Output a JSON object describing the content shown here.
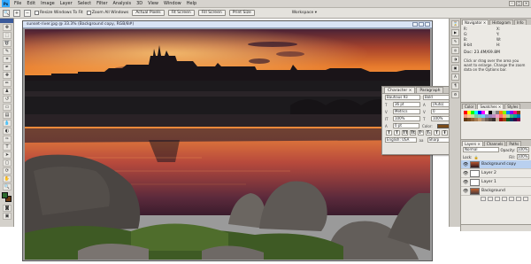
{
  "menubar": {
    "app_badge": "Ps",
    "items": [
      "File",
      "Edit",
      "Image",
      "Layer",
      "Select",
      "Filter",
      "Analysis",
      "3D",
      "View",
      "Window",
      "Help"
    ]
  },
  "options": {
    "tool_glyph": "🔍",
    "resize_windows_label": "Resize Windows To Fit",
    "zoom_all_label": "Zoom All Windows",
    "actual_pixels_label": "Actual Pixels",
    "fit_screen_label": "Fit Screen",
    "fill_screen_label": "Fill Screen",
    "print_size_label": "Print Size",
    "workspace_label": "Workspace ▾"
  },
  "document": {
    "title": "sunset-river.jpg @ 33.3% (Background copy, RGB/8#)"
  },
  "character_panel": {
    "tabs": [
      "Character ×",
      "Paragraph"
    ],
    "font_family": "Bauhaus 93",
    "font_style": "Bold",
    "font_size": "36 pt",
    "leading": "(Auto)",
    "tracking": "0",
    "kerning": "Metrics",
    "vscale": "100%",
    "hscale": "100%",
    "baseline": "0 pt",
    "color_label": "Color:",
    "style_buttons": [
      "T",
      "T",
      "TT",
      "Tt",
      "T¹",
      "T₁",
      "T",
      "Ŧ"
    ],
    "language": "English: USA",
    "antialias": "Sharp"
  },
  "navigator": {
    "tabs": [
      "Navigator ×",
      "Histogram",
      "Info"
    ],
    "doc_size": "Doc: 23.4M/69.8M",
    "info_values": [
      "R:",
      "G:",
      "B:",
      "8-bit",
      "X:",
      "Y:",
      "W:",
      "H:"
    ],
    "help_text": "Click or drag over the area you want to enlarge. Change the zoom data on the Options bar."
  },
  "swatches": {
    "tabs": [
      "Color",
      "Swatches ×",
      "Styles"
    ],
    "colors": [
      "#ff0000",
      "#ffff00",
      "#00ff00",
      "#00ffff",
      "#0000ff",
      "#ff00ff",
      "#ffffff",
      "#000000",
      "#c0c0c0",
      "#808080",
      "#ff8000",
      "#80ff00",
      "#0080ff",
      "#8000ff",
      "#ff0080",
      "#804000",
      "#f7977a",
      "#fdc68a",
      "#c4df9b",
      "#82ca9d",
      "#7bcdc8",
      "#6ecff6",
      "#8493ca",
      "#a187be",
      "#bc8dbf",
      "#f49ac2",
      "#f26d7d",
      "#fbaf5d",
      "#a3d39c",
      "#3cb878",
      "#00a99d",
      "#0072bc",
      "#603913",
      "#754c24",
      "#8c6239",
      "#a67c52",
      "#c69c6d",
      "#998675",
      "#736357",
      "#534741",
      "#362f2d",
      "#c7b299",
      "#9e0b0f",
      "#a0410d",
      "#005e20",
      "#003663",
      "#32004b",
      "#7b0046"
    ]
  },
  "layers": {
    "tabs": [
      "Layers ×",
      "Channels",
      "Paths"
    ],
    "blend_mode": "Normal",
    "opacity_label": "Opacity:",
    "opacity": "100%",
    "lock_label": "Lock:",
    "fill_label": "Fill:",
    "fill": "100%",
    "items": [
      {
        "name": "Background copy",
        "selected": true
      },
      {
        "name": "Layer 2",
        "selected": false
      },
      {
        "name": "Layer 1",
        "selected": false
      },
      {
        "name": "Background",
        "selected": false
      }
    ]
  }
}
